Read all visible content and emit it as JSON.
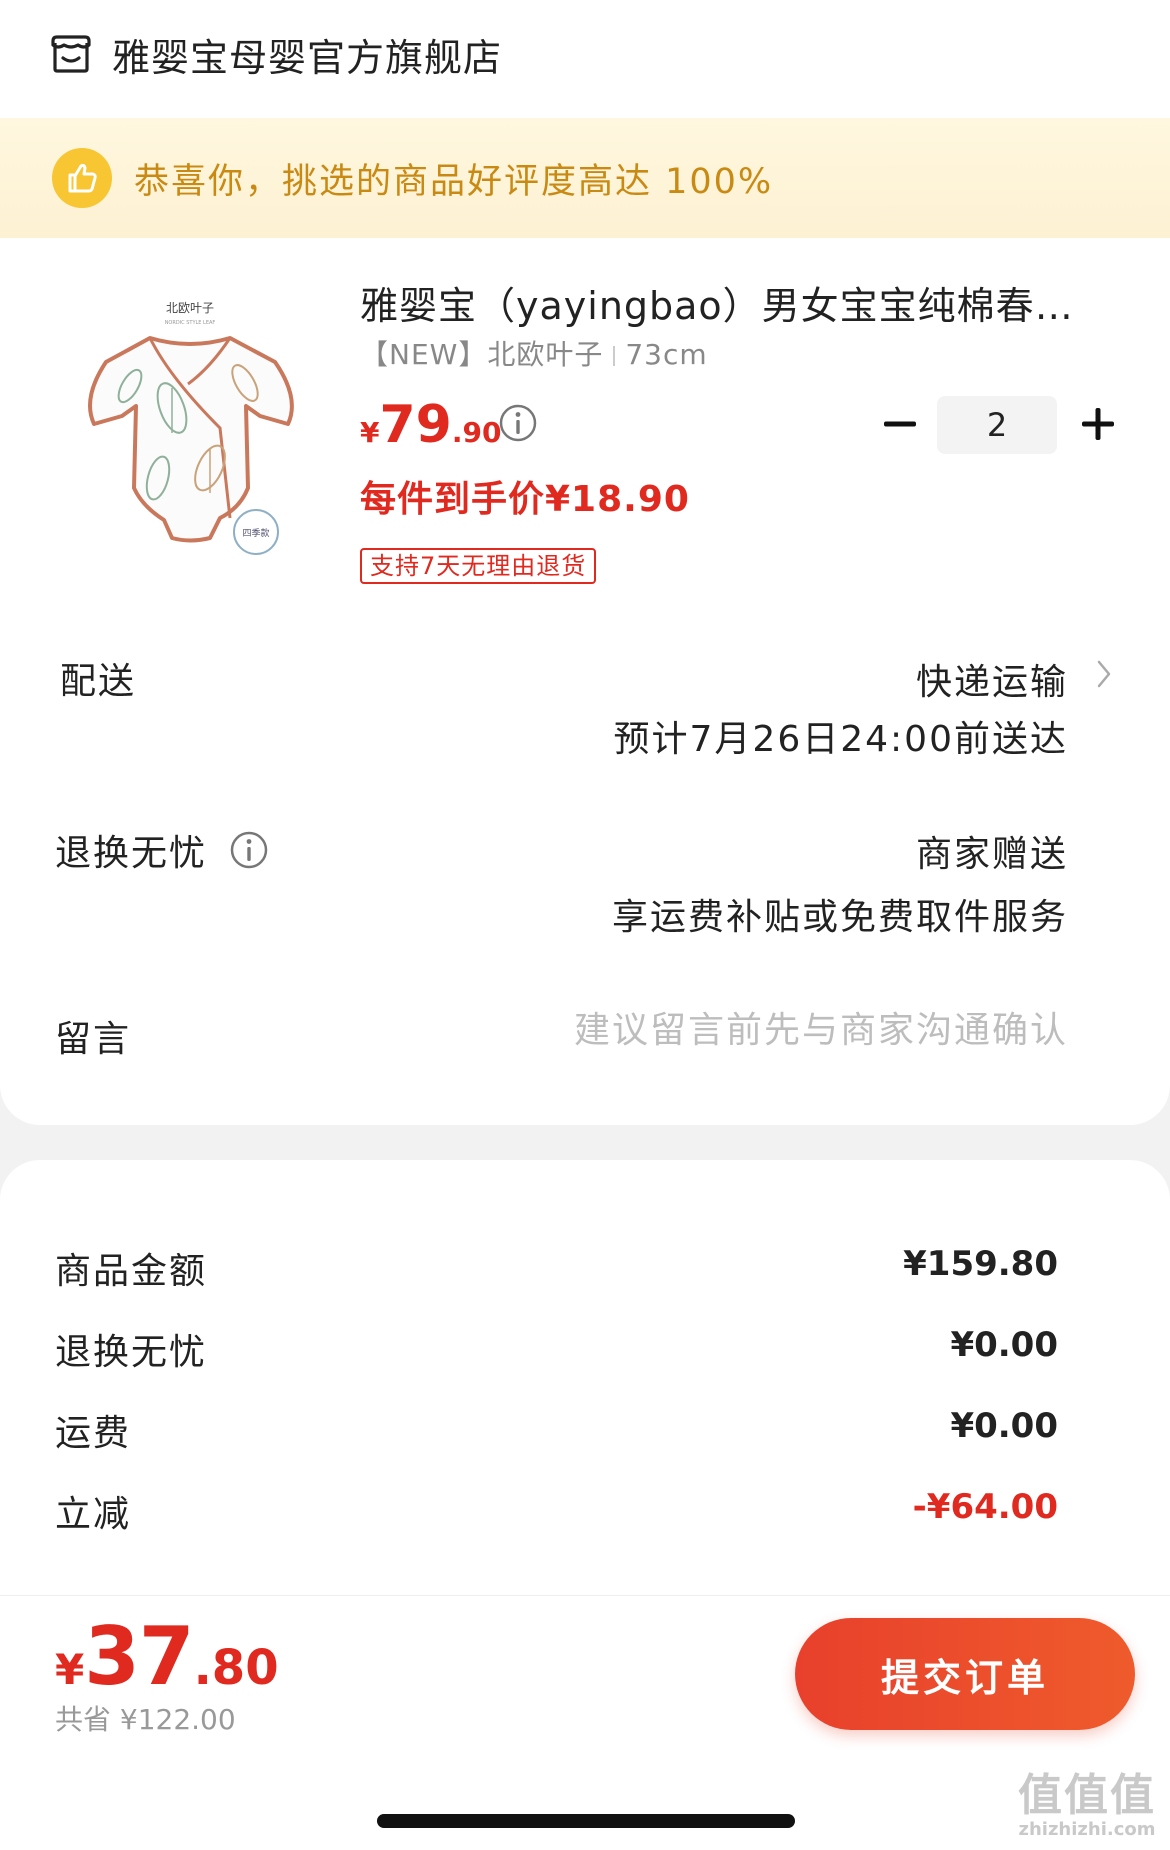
{
  "header": {
    "store_name": "雅婴宝母婴官方旗舰店",
    "store_icon": "store-icon"
  },
  "rating_banner": {
    "text": "恭喜你，挑选的商品好评度高达 100%",
    "icon": "thumbs-up-icon"
  },
  "product": {
    "title": "雅婴宝（yayingbao）男女宝宝纯棉春夏连体衣",
    "spec_collection": "【NEW】北欧叶子",
    "spec_size": "73cm",
    "price_yen": "¥",
    "price_int": "79",
    "price_dec": ".90",
    "quantity": "2",
    "unit_price": "每件到手价¥18.90",
    "return_badge": "支持7天无理由退货",
    "image_texts": {
      "brand_line": "北欧叶子",
      "sub_line": "NORDIC STYLE LEAF",
      "season_tag": "四季款"
    }
  },
  "delivery": {
    "label": "配送",
    "method": "快递运输",
    "eta": "预计7月26日24:00前送达"
  },
  "return_service": {
    "label": "退换无忧",
    "value_line1": "商家赠送",
    "value_line2": "享运费补贴或免费取件服务"
  },
  "message": {
    "label": "留言",
    "placeholder": "建议留言前先与商家沟通确认"
  },
  "summary": {
    "rows": [
      {
        "label": "商品金额",
        "value": "¥159.80"
      },
      {
        "label": "退换无忧",
        "value": "¥0.00"
      },
      {
        "label": "运费",
        "value": "¥0.00"
      },
      {
        "label": "立减",
        "value": "-¥64.00"
      }
    ]
  },
  "checkout": {
    "total_yen": "¥",
    "total_int": "37",
    "total_dec": ".80",
    "saved": "共省 ¥122.00",
    "submit_label": "提交订单"
  },
  "watermark": {
    "mark": "值值值",
    "url": "zhizhizhi.com"
  },
  "colors": {
    "accent_red": "#e0291f",
    "banner_bg": "#fdf1d3",
    "banner_text": "#c98a13",
    "thumb_yellow": "#f7c632"
  }
}
